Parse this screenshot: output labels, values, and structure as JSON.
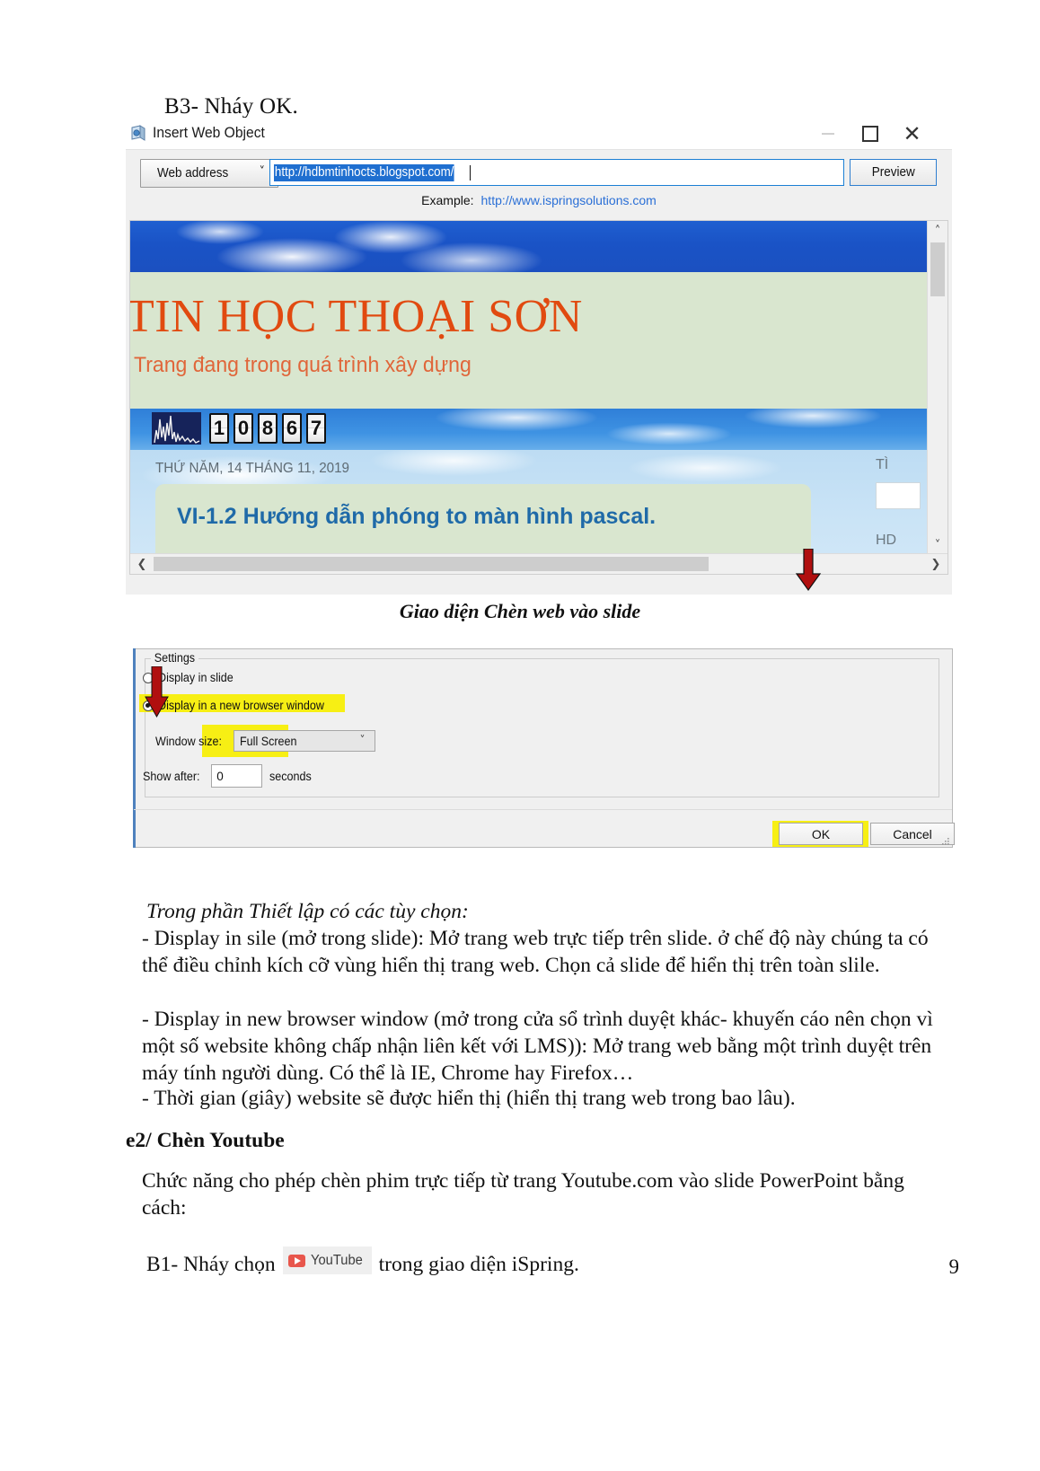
{
  "document": {
    "b3_heading": "B3- Nháy  OK.",
    "caption_1": "Giao diện Chèn web vào slide",
    "page_number": "9",
    "paragraphs": {
      "intro": "Trong phần Thiết lập có các tùy chọn:",
      "p1": "- Display in sile (mở trong slide): Mở trang web trực tiếp trên slide. ở chế độ này chúng ta có thể điều chỉnh kích cỡ vùng hiển thị trang web. Chọn cả slide để hiển thị trên toàn slile.",
      "p2": "- Display in new browser window (mở trong cửa sổ trình duyệt khác- khuyến cáo nên chọn vì một số website không chấp nhận liên kết với LMS)): Mở trang web bằng một trình duyệt trên máy tính người dùng. Có thể là IE, Chrome hay Firefox…",
      "p3": "- Thời gian (giây) website sẽ được hiển thị (hiển thị trang web trong bao lâu).",
      "p4": "Chức năng cho phép chèn phim trực tiếp từ trang Youtube.com vào slide PowerPoint bằng cách:"
    },
    "heading_e2": "e2/ Chèn Youtube",
    "b1_line": {
      "before": "B1- Nháy chọn",
      "after": "trong giao diện iSpring."
    }
  },
  "insert_web_object_window": {
    "title": "Insert Web Object",
    "window_controls": {
      "minimize": "–",
      "maximize": "❐",
      "close": "✕"
    },
    "address_bar": {
      "type_selector_label": "Web address",
      "type_selector_chevron": "˅",
      "url_value": "http://hdbmtinhocts.blogspot.com/",
      "preview_button": "Preview"
    },
    "example_row": {
      "label": "Example:",
      "url": "http://www.ispringsolutions.com"
    },
    "scrollbars": {
      "up_arrow": "˄",
      "down_arrow": "˅",
      "left_arrow": "❮",
      "right_arrow": "❯"
    }
  },
  "web_preview": {
    "site_title": "TIN HỌC THOẠI SƠN",
    "site_subtitle": "Trang đang trong quá trình xây dựng",
    "visitor_counter": [
      "1",
      "0",
      "8",
      "6",
      "7"
    ],
    "post_date": "THỨ NĂM, 14 THÁNG 11, 2019",
    "post_title": "VI-1.2 Hướng dẫn phóng to màn hình pascal.",
    "sidebar_label_1": "TÌ",
    "sidebar_label_2": "HD",
    "colors": {
      "title_orange": "#e14a10",
      "panel_green": "#d9e6cf",
      "sky_blue": "#1f5fd0",
      "post_title_blue": "#1f6aa8"
    }
  },
  "settings_dialog": {
    "group_legend": "Settings",
    "radio_display_in_slide": "Display in slide",
    "radio_display_in_new_window": "Display in a new browser window",
    "selected_radio": "display_in_new_browser_window",
    "window_size_label": "Window size:",
    "window_size_value": "Full Screen",
    "window_size_chevron": "˅",
    "show_after_label": "Show after:",
    "show_after_value": "0",
    "show_after_unit": "seconds",
    "ok_button": "OK",
    "cancel_button": "Cancel",
    "highlight_color": "#f7ef14",
    "arrow_color": "#aa1111"
  },
  "youtube_chip": {
    "label": "YouTube",
    "icon": "youtube-play-icon",
    "brand_color": "#e8564c"
  }
}
